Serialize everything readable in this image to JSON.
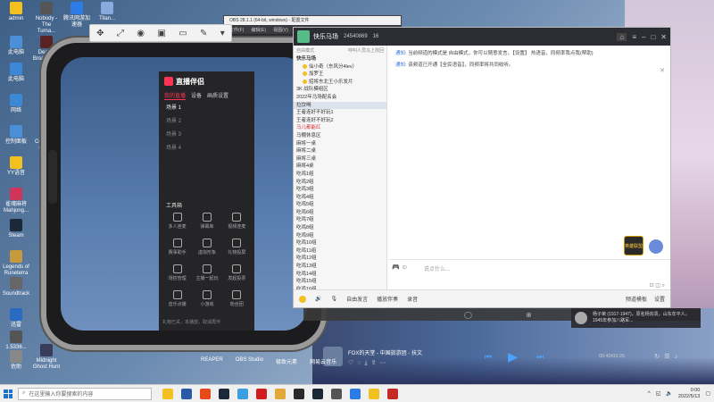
{
  "desktop": {
    "icons": [
      {
        "label": "admin",
        "color": "#f3c11f"
      },
      {
        "label": "Nobody - The Turna...",
        "color": "#555555"
      },
      {
        "label": "腾讯网游加速器",
        "color": "#2d7be5"
      },
      {
        "label": "Titan...",
        "color": "#88aadd"
      },
      {
        "label": "此电脑",
        "color": "#4a8fd8"
      },
      {
        "label": "Deadly Broadcas...",
        "color": "#5a2222"
      },
      {
        "label": "此电脑",
        "color": "#3c87d6"
      },
      {
        "label": "网络",
        "color": "#3c87d6"
      },
      {
        "label": "腾讯",
        "color": "#2a6ac4"
      },
      {
        "label": "控制面板",
        "color": "#4a8fd8"
      },
      {
        "label": "Counter... Global",
        "color": "#ffa000"
      },
      {
        "label": "YY语音",
        "color": "#f3c11f"
      },
      {
        "label": "雀魂麻将 Mahjong...",
        "color": "#d0345a"
      },
      {
        "label": "Steam",
        "color": "#1b2838"
      },
      {
        "label": "Epic",
        "color": "#333333"
      },
      {
        "label": "Legends of Runeterra",
        "color": "#c69a3a"
      },
      {
        "label": "Soundtrack",
        "color": "#666666"
      },
      {
        "label": "Sekiro",
        "color": "#8a1a1a"
      },
      {
        "label": "迅雷",
        "color": "#2a6ac4"
      },
      {
        "label": "1.5336...",
        "color": "#555555"
      },
      {
        "label": "Midnight Ghost Hunt",
        "color": "#3b3b5a"
      },
      {
        "label": "佐助",
        "color": "#888888"
      }
    ],
    "dock_labels": [
      "REAPER",
      "OBS Studio",
      "极致元素",
      "网易云音乐"
    ],
    "dock_left_label": "佐助"
  },
  "capture_toolbar": {
    "icons": [
      "pointer-icon",
      "expand-icon",
      "camera-icon",
      "record-icon",
      "screen-icon",
      "pen-icon",
      "collapse-icon"
    ]
  },
  "live_panel": {
    "title": "直播伴侣",
    "tabs": [
      "我的直播",
      "设备",
      "画质设置"
    ],
    "scenes": [
      "场景 1",
      "场景 2",
      "场景 3",
      "场景 4"
    ],
    "tools_title": "工具箱",
    "tools": [
      "多人连麦",
      "弹幕库",
      "视频连麦",
      "赛事助手",
      "虚拟形象",
      "礼物投屏",
      "场控管理",
      "主播一起玩",
      "发起投票",
      "音乐点播",
      "小游戏",
      "粉丝团"
    ],
    "footer": "礼物已关，本播放，取消再作"
  },
  "obs": {
    "title": "OBS 28.1.1 (64-bit, windows) - 配置文件",
    "menu": [
      "文件(F)",
      "编辑(E)",
      "视图(V)"
    ]
  },
  "chat": {
    "room_name": "快乐马场",
    "room_id": "24540869",
    "online": "16",
    "channel_header": {
      "left": "自由模式",
      "right": "呼叫人员马上找回"
    },
    "channels": [
      {
        "label": "快乐马场",
        "level": 0,
        "style": "bold"
      },
      {
        "label": "仙小奇（东风分4lev）",
        "level": 1,
        "style": "badge"
      },
      {
        "label": "加罗王",
        "level": 1,
        "style": "badge"
      },
      {
        "label": "招将东北王小乐发片",
        "level": 1,
        "style": "badge"
      },
      {
        "label": "3K 战队模组区",
        "level": 0,
        "style": "normal"
      },
      {
        "label": "2022年马场配名会",
        "level": 0,
        "style": "normal"
      },
      {
        "label": "拉饮喝",
        "level": 0,
        "style": "selected"
      },
      {
        "label": "王者连好不好玩1",
        "level": 0,
        "style": "normal"
      },
      {
        "label": "王者连好不好玩2",
        "level": 0,
        "style": "normal"
      },
      {
        "label": "马儿都能红",
        "level": 0,
        "style": "red"
      },
      {
        "label": "马棚休息区",
        "level": 0,
        "style": "normal"
      },
      {
        "label": "麻将一桌",
        "level": 0,
        "style": "normal"
      },
      {
        "label": "麻将二桌",
        "level": 0,
        "style": "normal"
      },
      {
        "label": "麻将三桌",
        "level": 0,
        "style": "normal"
      },
      {
        "label": "麻将4桌",
        "level": 0,
        "style": "normal"
      },
      {
        "label": "吃鸡1组",
        "level": 0,
        "style": "normal"
      },
      {
        "label": "吃鸡2组",
        "level": 0,
        "style": "normal"
      },
      {
        "label": "吃鸡3组",
        "level": 0,
        "style": "normal"
      },
      {
        "label": "吃鸡4组",
        "level": 0,
        "style": "normal"
      },
      {
        "label": "吃鸡5组",
        "level": 0,
        "style": "normal"
      },
      {
        "label": "吃鸡6组",
        "level": 0,
        "style": "normal"
      },
      {
        "label": "吃鸡7组",
        "level": 0,
        "style": "normal"
      },
      {
        "label": "吃鸡8组",
        "level": 0,
        "style": "normal"
      },
      {
        "label": "吃鸡9组",
        "level": 0,
        "style": "normal"
      },
      {
        "label": "吃鸡10组",
        "level": 0,
        "style": "normal"
      },
      {
        "label": "吃鸡11组",
        "level": 0,
        "style": "normal"
      },
      {
        "label": "吃鸡12组",
        "level": 0,
        "style": "normal"
      },
      {
        "label": "吃鸡13组",
        "level": 0,
        "style": "normal"
      },
      {
        "label": "吃鸡14组",
        "level": 0,
        "style": "normal"
      },
      {
        "label": "吃鸡15组",
        "level": 0,
        "style": "normal"
      },
      {
        "label": "吃鸡16组",
        "level": 0,
        "style": "normal"
      }
    ],
    "notices": [
      {
        "key": "通知:",
        "text": "当前频道的模式是 自由模式，你可以随意发言。【设置】 热语音，同频率我点我(帮助)"
      },
      {
        "key": "通知:",
        "text": "该频道已开通【全民语音】，同频率将共同收听。"
      }
    ],
    "game_icon_label": "英雄联盟",
    "input_placeholder": "说点什么...",
    "bottom_bar": [
      "自由发言",
      "播放伴奏",
      "录音"
    ],
    "bottom_right": [
      "频道模板",
      "设置"
    ]
  },
  "news": {
    "text": "杨子荣 (1917-1947)，原名杨宗贵，山东牟平人。1945年参加八路军..."
  },
  "player": {
    "song": "FOX的天堂 - 中国旅游团 - 扶文",
    "time": "00:40/03:26",
    "action_icons": [
      "heart-icon",
      "comment-icon",
      "download-icon",
      "share-icon",
      "more-icon"
    ]
  },
  "taskbar": {
    "search_placeholder": "在这里输入你要搜索的内容",
    "app_colors": [
      "#f3c11f",
      "#2b5aa8",
      "#e64a19",
      "#1b2838",
      "#3a9ee0",
      "#d01e1e",
      "#e2a93a",
      "#2a2a2a",
      "#1b2838",
      "#555555",
      "#2d7be5",
      "#f3c11f",
      "#c62828"
    ],
    "time": "0:00",
    "date": "2022/5/13"
  }
}
